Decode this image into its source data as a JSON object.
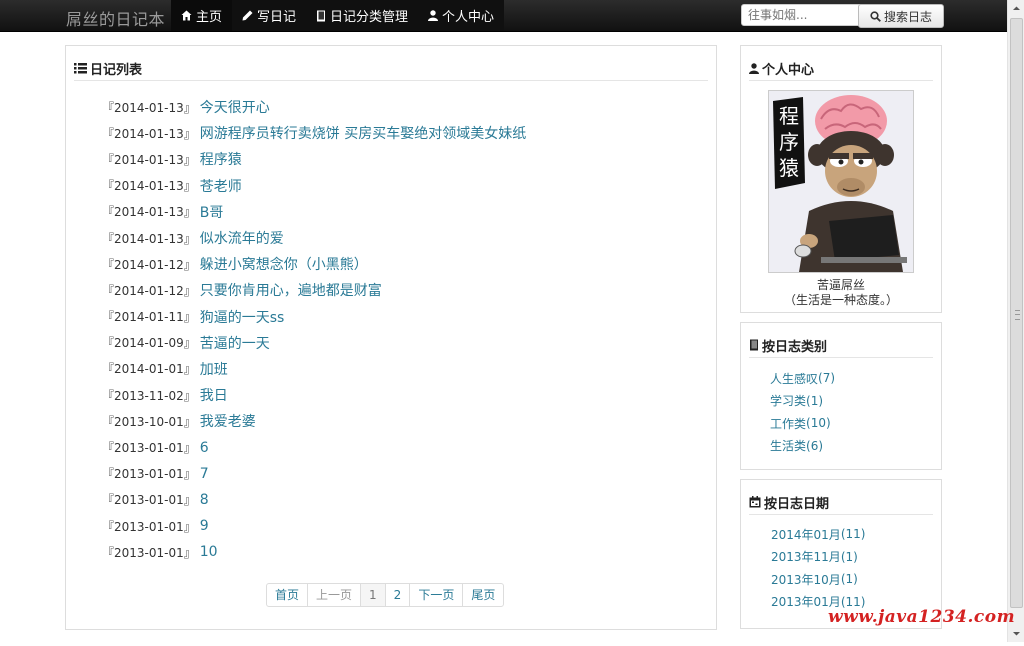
{
  "navbar": {
    "brand": "屌丝的日记本",
    "items": [
      {
        "label": "主页",
        "icon": "home-icon"
      },
      {
        "label": "写日记",
        "icon": "pencil-icon"
      },
      {
        "label": "日记分类管理",
        "icon": "book-icon"
      },
      {
        "label": "个人中心",
        "icon": "user-icon"
      }
    ],
    "search": {
      "placeholder": "往事如烟...",
      "button_label": "搜索日志"
    }
  },
  "diary_panel": {
    "title": "日记列表",
    "items": [
      {
        "date": "『2014-01-13』",
        "title": "今天很开心"
      },
      {
        "date": "『2014-01-13』",
        "title": "网游程序员转行卖烧饼 买房买车娶绝对领域美女妹纸"
      },
      {
        "date": "『2014-01-13』",
        "title": "程序猿"
      },
      {
        "date": "『2014-01-13』",
        "title": "苍老师"
      },
      {
        "date": "『2014-01-13』",
        "title": "B哥"
      },
      {
        "date": "『2014-01-13』",
        "title": "似水流年的爱"
      },
      {
        "date": "『2014-01-12』",
        "title": "躲进小窝想念你（小黑熊）"
      },
      {
        "date": "『2014-01-12』",
        "title": "只要你肯用心，遍地都是财富"
      },
      {
        "date": "『2014-01-11』",
        "title": "狗逼的一天ss"
      },
      {
        "date": "『2014-01-09』",
        "title": "苦逼的一天"
      },
      {
        "date": "『2014-01-01』",
        "title": "加班"
      },
      {
        "date": "『2013-11-02』",
        "title": "我日"
      },
      {
        "date": "『2013-10-01』",
        "title": "我爱老婆"
      },
      {
        "date": "『2013-01-01』",
        "title": "6"
      },
      {
        "date": "『2013-01-01』",
        "title": "7"
      },
      {
        "date": "『2013-01-01』",
        "title": "8"
      },
      {
        "date": "『2013-01-01』",
        "title": "9"
      },
      {
        "date": "『2013-01-01』",
        "title": "10"
      }
    ],
    "pagination": {
      "first": "首页",
      "prev": "上一页",
      "pages": [
        "1",
        "2"
      ],
      "next": "下一页",
      "last": "尾页"
    }
  },
  "profile_panel": {
    "title": "个人中心",
    "avatar_text": "程序猿",
    "name": "苦逼屌丝",
    "motto": "（生活是一种态度。）"
  },
  "category_panel": {
    "title": "按日志类别",
    "items": [
      {
        "name": "人生感叹",
        "count": "(7)"
      },
      {
        "name": "学习类",
        "count": "(1)"
      },
      {
        "name": "工作类",
        "count": "(10)"
      },
      {
        "name": "生活类",
        "count": "(6)"
      }
    ]
  },
  "date_panel": {
    "title": "按日志日期",
    "items": [
      {
        "name": "2014年01月",
        "count": "(11)"
      },
      {
        "name": "2013年11月",
        "count": "(1)"
      },
      {
        "name": "2013年10月",
        "count": "(1)"
      },
      {
        "name": "2013年01月",
        "count": "(11)"
      }
    ]
  },
  "watermark": "www.java1234.com",
  "colors": {
    "link": "#2a7a96",
    "navbar": "#1b1b1b",
    "watermark": "#d42222"
  }
}
